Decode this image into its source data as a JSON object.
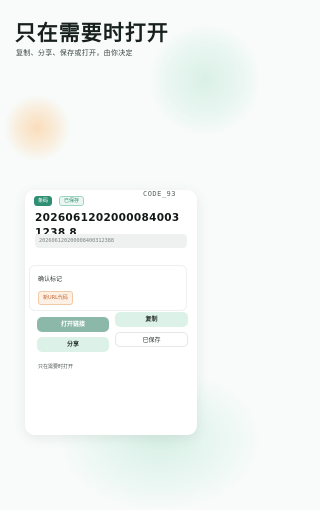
{
  "header": {
    "title": "只在需要时打开",
    "subtitle": "复制、分享、保存或打开，由你决定"
  },
  "card": {
    "badges": [
      "条码",
      "已保存"
    ],
    "code_type": "CODE_93",
    "code_value": "20260612020000840031238 8",
    "code_raw": "202606120200008400312388",
    "mark_section": {
      "title": "确认标记",
      "tag": "新URL代码"
    },
    "actions": {
      "open": "打开链接",
      "copy": "复制",
      "share": "分享",
      "saved": "已保存"
    },
    "footnote": "只在需要时打开"
  },
  "colors": {
    "accent": "#2f8f72",
    "primary_button": "#8bb8a8",
    "soft_button": "#dcf2e9",
    "tag_text": "#c5652e"
  }
}
